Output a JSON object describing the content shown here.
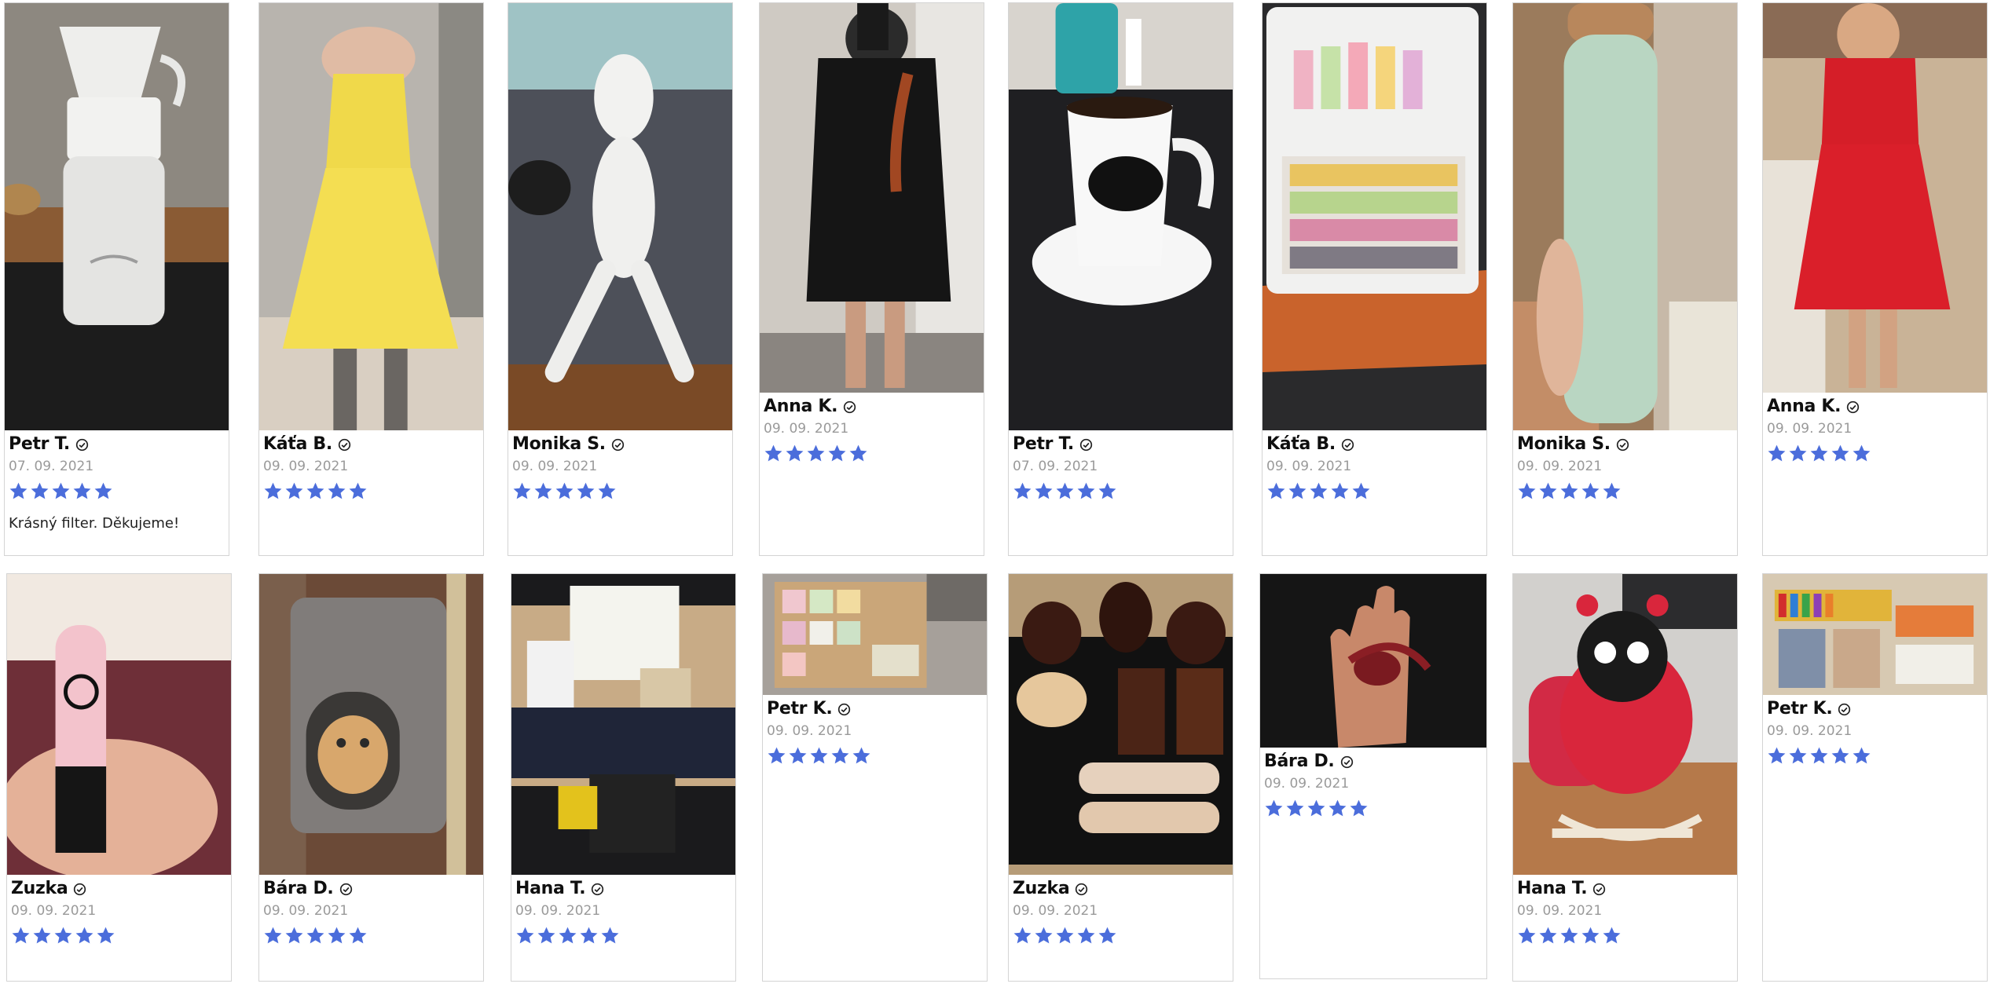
{
  "colors": {
    "star": "#4b6ddb",
    "card_border": "#d4d4d4",
    "date_text": "#9a9a9a"
  },
  "icons": {
    "verified": "verified-check-icon",
    "star": "star-icon"
  },
  "reviews": [
    {
      "name": "Petr T.",
      "date": "07. 09. 2021",
      "rating": 5,
      "comment": "Krásný filter. Děkujeme!",
      "photo": "coffee-dripper-on-mug"
    },
    {
      "name": "Káťa B.",
      "date": "09. 09. 2021",
      "rating": 5,
      "comment": "",
      "photo": "yellow-dress-mirror-selfie"
    },
    {
      "name": "Monika S.",
      "date": "09. 09. 2021",
      "rating": 5,
      "comment": "",
      "photo": "white-plush-bunny-on-sofa"
    },
    {
      "name": "Anna K.",
      "date": "09. 09. 2021",
      "rating": 5,
      "comment": "",
      "photo": "black-dress-mirror-selfie"
    },
    {
      "name": "Petr T.",
      "date": "07. 09. 2021",
      "rating": 5,
      "comment": "",
      "photo": "espresso-cup-on-saucer"
    },
    {
      "name": "Káťa B.",
      "date": "09. 09. 2021",
      "rating": 5,
      "comment": "",
      "photo": "waterdrop-gift-box"
    },
    {
      "name": "Monika S.",
      "date": "09. 09. 2021",
      "rating": 5,
      "comment": "",
      "photo": "waterdrop-bottle-in-hand"
    },
    {
      "name": "Anna K.",
      "date": "09. 09. 2021",
      "rating": 5,
      "comment": "",
      "photo": "red-dress-mirror-selfie"
    },
    {
      "name": "Zuzka",
      "date": "09. 09. 2021",
      "rating": 5,
      "comment": "",
      "photo": "oncolour-lip-balm-in-hand"
    },
    {
      "name": "Bára D.",
      "date": "09. 09. 2021",
      "rating": 5,
      "comment": "",
      "photo": "kitten-in-cat-tree"
    },
    {
      "name": "Hana T.",
      "date": "09. 09. 2021",
      "rating": 5,
      "comment": "",
      "photo": "baby-gift-box-bibs"
    },
    {
      "name": "Petr K.",
      "date": "09. 09. 2021",
      "rating": 5,
      "comment": "",
      "photo": "boxed-gift-set"
    },
    {
      "name": "Zuzka",
      "date": "09. 09. 2021",
      "rating": 5,
      "comment": "",
      "photo": "box-of-cakes"
    },
    {
      "name": "Bára D.",
      "date": "09. 09. 2021",
      "rating": 5,
      "comment": "",
      "photo": "red-item-in-palm"
    },
    {
      "name": "Hana T.",
      "date": "09. 09. 2021",
      "rating": 5,
      "comment": "",
      "photo": "ladybug-rocking-toy"
    },
    {
      "name": "Petr K.",
      "date": "09. 09. 2021",
      "rating": 5,
      "comment": "",
      "photo": "colored-pencils-and-cards"
    }
  ]
}
